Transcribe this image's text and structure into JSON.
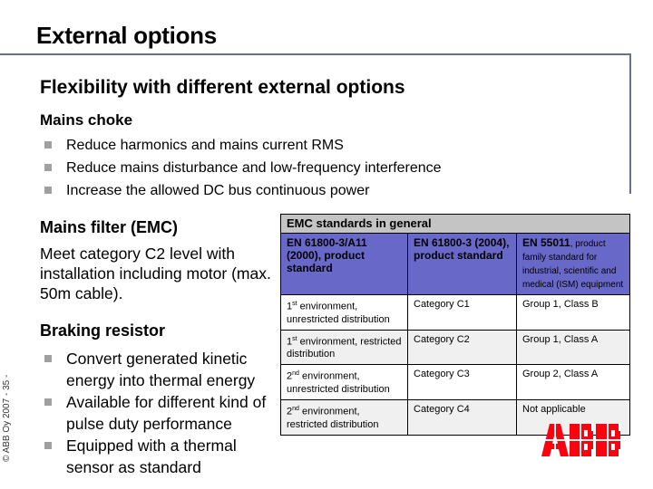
{
  "slide": {
    "title": "External options",
    "subtitle": "Flexibility with different external options",
    "footer_side": "© ABB Oy 2007  - 35 -"
  },
  "mains_choke": {
    "heading": "Mains choke",
    "bullets": [
      "Reduce harmonics and mains current RMS",
      "Reduce mains disturbance and low-frequency interference",
      "Increase the allowed DC bus continuous power"
    ]
  },
  "mains_filter": {
    "heading": "Mains filter (EMC)",
    "text": "Meet category C2 level with installation including motor (max. 50m cable)."
  },
  "braking_resistor": {
    "heading": "Braking resistor",
    "bullets": [
      "Convert generated kinetic energy into thermal energy",
      "Available for different kind of pulse duty performance",
      "Equipped with a thermal sensor as standard"
    ]
  },
  "emc_table": {
    "header": "EMC standards in general",
    "columns": [
      {
        "bold": "EN 61800-3/A11 (2000), product standard",
        "normal": ""
      },
      {
        "bold": "EN 61800-3 (2004), product standard",
        "normal": ""
      },
      {
        "bold": "EN 55011",
        "normal": ", product family standard for industrial, scientific and medical (ISM) equipment"
      }
    ],
    "rows": [
      {
        "ord": "1",
        "sup": "st",
        "env": " environment, unrestricted distribution",
        "cat": "Category C1",
        "group": "Group 1, Class B"
      },
      {
        "ord": "1",
        "sup": "st",
        "env": " environment, restricted distribution",
        "cat": "Category C2",
        "group": "Group 1, Class A"
      },
      {
        "ord": "2",
        "sup": "nd",
        "env": " environment, unrestricted distribution",
        "cat": "Category C3",
        "group": "Group 2, Class A"
      },
      {
        "ord": "2",
        "sup": "nd",
        "env": " environment, restricted distribution",
        "cat": "Category C4",
        "group": "Not applicable"
      }
    ]
  },
  "logo": {
    "text": "ABB",
    "color": "#ff000f"
  },
  "colors": {
    "frame": "#6a6e92",
    "header_gray": "#c4c4c4",
    "standards_blue": "#6868c8",
    "bullet": "#a0a0a0"
  }
}
